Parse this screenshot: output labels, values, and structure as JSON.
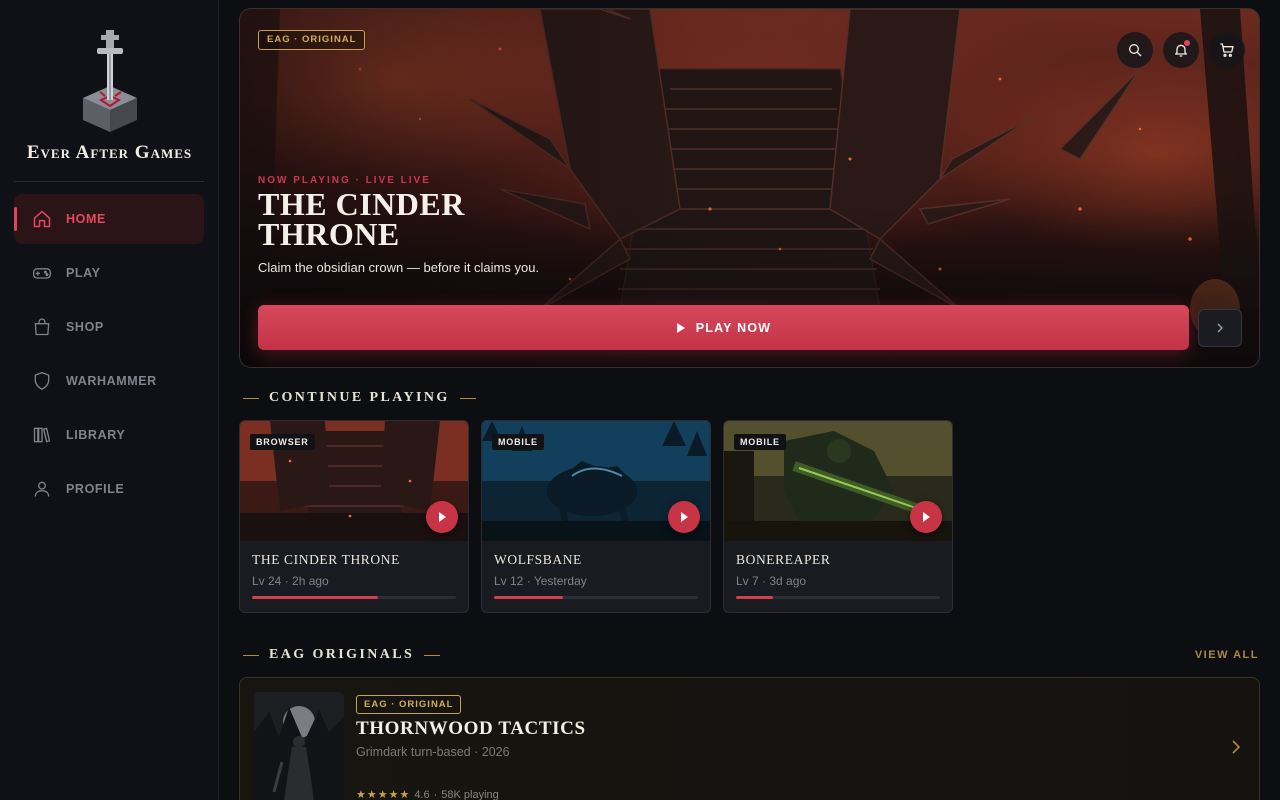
{
  "brand": {
    "name": "Ever After Games"
  },
  "nav": [
    {
      "label": "HOME",
      "icon": "home-icon",
      "active": true
    },
    {
      "label": "PLAY",
      "icon": "gamepad-icon",
      "active": false
    },
    {
      "label": "SHOP",
      "icon": "shopping-bag-icon",
      "active": false
    },
    {
      "label": "WARHAMMER",
      "icon": "shield-icon",
      "active": false
    },
    {
      "label": "LIBRARY",
      "icon": "library-icon",
      "active": false
    },
    {
      "label": "PROFILE",
      "icon": "user-icon",
      "active": false
    }
  ],
  "hero": {
    "badge": "EAG · ORIGINAL",
    "kicker": "NOW PLAYING · LIVE LIVE",
    "title": "THE CINDER THRONE",
    "subtitle": "Claim the obsidian crown — before it claims you.",
    "play_label": "PLAY NOW",
    "icons": [
      "search-icon",
      "bell-icon",
      "cart-icon"
    ]
  },
  "continue": {
    "title": "CONTINUE PLAYING",
    "cards": [
      {
        "tag": "BROWSER",
        "title": "THE CINDER THRONE",
        "level": "Lv 24",
        "time": "2h ago",
        "progress": 0.62
      },
      {
        "tag": "MOBILE",
        "title": "WOLFSBANE",
        "level": "Lv 12",
        "time": "Yesterday",
        "progress": 0.34
      },
      {
        "tag": "MOBILE",
        "title": "BONEREAPER",
        "level": "Lv 7",
        "time": "3d ago",
        "progress": 0.18
      }
    ]
  },
  "originals": {
    "title": "EAG ORIGINALS",
    "view_all": "VIEW ALL",
    "featured": {
      "badge": "EAG · ORIGINAL",
      "title": "THORNWOOD TACTICS",
      "subtitle": "Grimdark turn-based · 2026",
      "rating": "4.6",
      "players": "58K playing",
      "stars": "★★★★★"
    }
  },
  "colors": {
    "accent": "#d8485b",
    "gold": "#c9a14a",
    "bg": "#0d0e12"
  }
}
